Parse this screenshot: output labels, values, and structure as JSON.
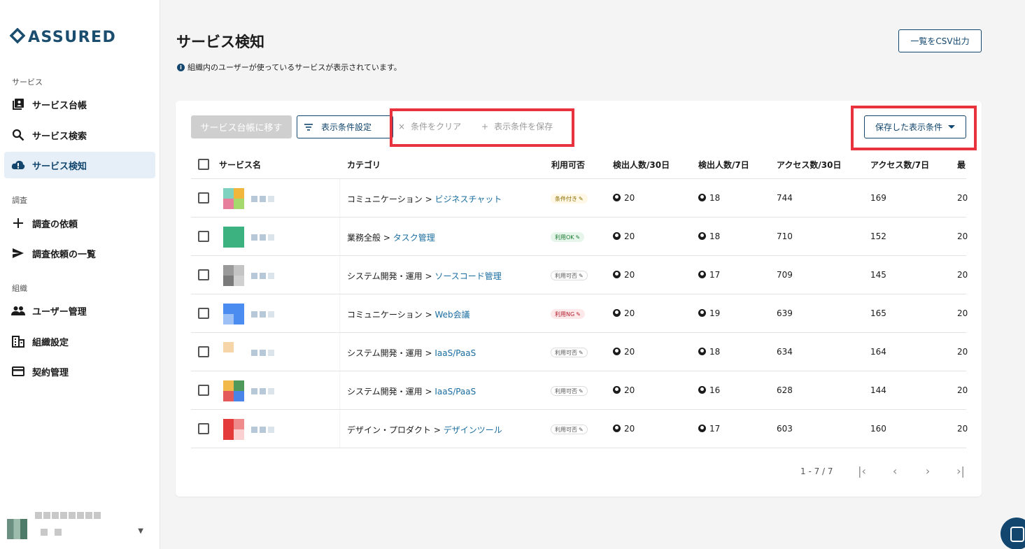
{
  "brand": {
    "name": "ASSURED",
    "color": "#1a4d6e"
  },
  "sidebar": {
    "sections": [
      {
        "label": "サービス"
      },
      {
        "label": "調査"
      },
      {
        "label": "組織"
      }
    ],
    "items": [
      {
        "label": "サービス台帳",
        "icon": "library-icon"
      },
      {
        "label": "サービス検索",
        "icon": "search-icon"
      },
      {
        "label": "サービス検知",
        "icon": "cloud-alert-icon",
        "active": true
      },
      {
        "label": "調査の依頼",
        "icon": "plus-icon"
      },
      {
        "label": "調査依頼の一覧",
        "icon": "send-icon"
      },
      {
        "label": "ユーザー管理",
        "icon": "people-icon"
      },
      {
        "label": "組織設定",
        "icon": "building-icon"
      },
      {
        "label": "契約管理",
        "icon": "credit-card-icon"
      }
    ]
  },
  "header": {
    "title": "サービス検知",
    "description": "組織内のユーザーが使っているサービスが表示されています。",
    "csv_button": "一覧をCSV出力"
  },
  "toolbar": {
    "move_button": "サービス台帳に移す",
    "filter_button": "表示条件設定",
    "clear_button": "条件をクリア",
    "save_button": "表示条件を保存",
    "saved_dropdown": "保存した表示条件"
  },
  "table": {
    "columns": [
      "サービス名",
      "カテゴリ",
      "利用可否",
      "検出人数/30日",
      "検出人数/7日",
      "アクセス数/30日",
      "アクセス数/7日",
      "最"
    ],
    "rows": [
      {
        "cat_prefix": "コミュニケーション > ",
        "cat_link": "ビジネスチャット",
        "status": "条件付き",
        "status_type": "warn",
        "d30": "20",
        "d7": "18",
        "a30": "744",
        "a7": "169",
        "last": "20"
      },
      {
        "cat_prefix": "業務全般 > ",
        "cat_link": "タスク管理",
        "status": "利用OK",
        "status_type": "ok",
        "d30": "20",
        "d7": "18",
        "a30": "710",
        "a7": "152",
        "last": "20"
      },
      {
        "cat_prefix": "システム開発・運用 > ",
        "cat_link": "ソースコード管理",
        "status": "利用可否",
        "status_type": "none",
        "d30": "20",
        "d7": "17",
        "a30": "709",
        "a7": "145",
        "last": "20"
      },
      {
        "cat_prefix": "コミュニケーション > ",
        "cat_link": "Web会議",
        "status": "利用NG",
        "status_type": "ng",
        "d30": "20",
        "d7": "19",
        "a30": "639",
        "a7": "165",
        "last": "20"
      },
      {
        "cat_prefix": "システム開発・運用 > ",
        "cat_link": "IaaS/PaaS",
        "status": "利用可否",
        "status_type": "none",
        "d30": "20",
        "d7": "18",
        "a30": "634",
        "a7": "164",
        "last": "20"
      },
      {
        "cat_prefix": "システム開発・運用 > ",
        "cat_link": "IaaS/PaaS",
        "status": "利用可否",
        "status_type": "none",
        "d30": "20",
        "d7": "16",
        "a30": "628",
        "a7": "144",
        "last": "20"
      },
      {
        "cat_prefix": "デザイン・プロダクト > ",
        "cat_link": "デザインツール",
        "status": "利用可否",
        "status_type": "none",
        "d30": "20",
        "d7": "17",
        "a30": "603",
        "a7": "160",
        "last": "20"
      }
    ]
  },
  "pagination": {
    "range": "1 - 7 / 7"
  },
  "colors": {
    "accent": "#12466e",
    "highlight": "#e8333f"
  }
}
